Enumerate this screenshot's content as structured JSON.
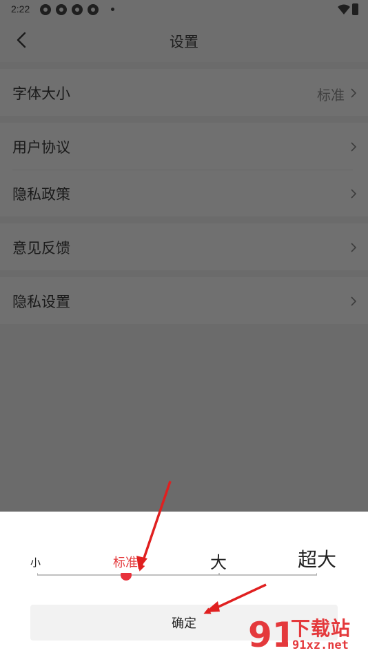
{
  "status_bar": {
    "time": "2:22"
  },
  "header": {
    "title": "设置",
    "back_icon": "chevron-left-icon"
  },
  "settings": {
    "font_size": {
      "label": "字体大小",
      "value": "标准"
    },
    "user_agreement": {
      "label": "用户协议"
    },
    "privacy_policy": {
      "label": "隐私政策"
    },
    "feedback": {
      "label": "意见反馈"
    },
    "privacy_settings": {
      "label": "隐私设置"
    }
  },
  "font_sheet": {
    "options": [
      "小",
      "标准",
      "大",
      "超大"
    ],
    "selected_index": 1,
    "selected_color": "#e4393c",
    "confirm_label": "确定"
  },
  "watermark": {
    "logo_text": "91",
    "title": "下载站",
    "url": "91xz.net"
  },
  "annotation_color": "#e02020"
}
